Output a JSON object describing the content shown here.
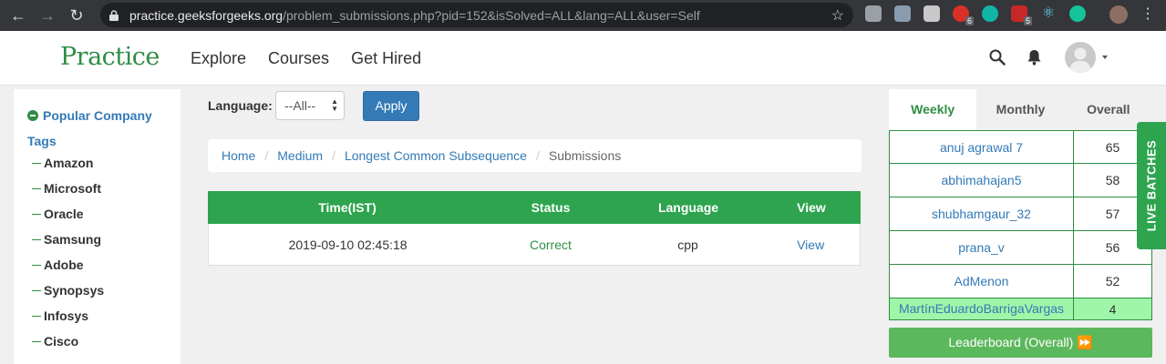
{
  "browser": {
    "url_host": "practice.geeksforgeeks.org",
    "url_path": "/problem_submissions.php?pid=152&isSolved=ALL&lang=ALL&user=Self",
    "ext_badges": [
      "6",
      "5"
    ]
  },
  "site": {
    "logo": "Practice",
    "nav": [
      "Explore",
      "Courses",
      "Get Hired"
    ],
    "brand_color": "#2f8d46"
  },
  "sidebar": {
    "title": "Popular Company Tags",
    "items": [
      "Amazon",
      "Microsoft",
      "Oracle",
      "Samsung",
      "Adobe",
      "Synopsys",
      "Infosys",
      "Cisco"
    ]
  },
  "filter": {
    "label": "Language:",
    "selected": "--All--",
    "apply": "Apply"
  },
  "breadcrumb": {
    "home": "Home",
    "level": "Medium",
    "problem": "Longest Common Subsequence",
    "current": "Submissions"
  },
  "submissions": {
    "headers": [
      "Time(IST)",
      "Status",
      "Language",
      "View"
    ],
    "rows": [
      {
        "time": "2019-09-10 02:45:18",
        "status": "Correct",
        "language": "cpp",
        "view": "View"
      }
    ]
  },
  "leaderboard": {
    "tabs": [
      "Weekly",
      "Monthly",
      "Overall"
    ],
    "rows": [
      {
        "name": "anuj agrawal 7",
        "score": "65"
      },
      {
        "name": "abhimahajan5",
        "score": "58"
      },
      {
        "name": "shubhamgaur_32",
        "score": "57"
      },
      {
        "name": "prana_v",
        "score": "56"
      },
      {
        "name": "AdMenon",
        "score": "52"
      }
    ],
    "me": {
      "name": "MartínEduardoBarrigaVargas",
      "score": "4"
    },
    "button": "Leaderboard (Overall) ⏩"
  },
  "live_tab": "LIVE  BATCHES"
}
